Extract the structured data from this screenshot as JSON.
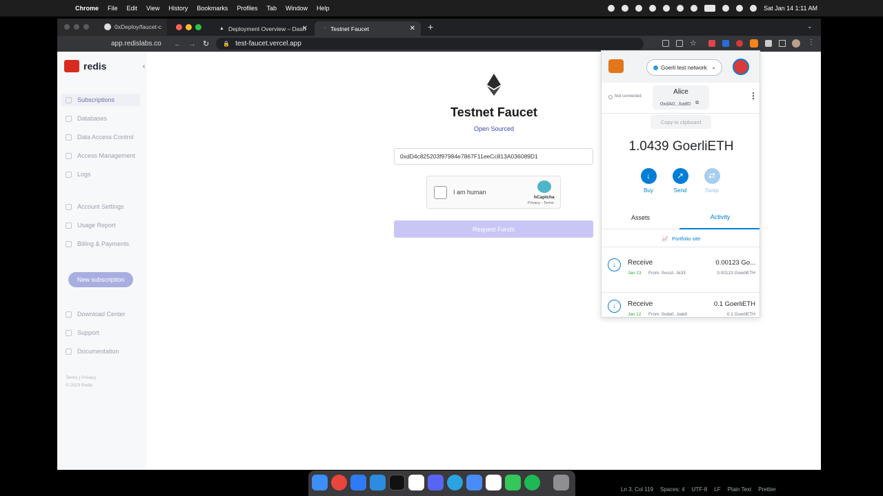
{
  "menubar": {
    "app": "Chrome",
    "items": [
      "File",
      "Edit",
      "View",
      "History",
      "Bookmarks",
      "Profiles",
      "Tab",
      "Window",
      "Help"
    ],
    "clock": "Sat Jan 14  1:11 AM"
  },
  "back_window": {
    "tab_label": "0xDeploy/faucet-c",
    "url": "app.redislabs.co",
    "logo": "redis",
    "nav": [
      "Subscriptions",
      "Databases",
      "Data Access Control",
      "Access Management",
      "Logs"
    ],
    "nav2": [
      "Account Settings",
      "Usage Report",
      "Billing & Payments"
    ],
    "new_subscription": "New subscription",
    "nav3": [
      "Download Center",
      "Support",
      "Documentation"
    ],
    "footer_links": "Terms  |  Privacy",
    "copyright": "© 2023 Redis"
  },
  "front_window": {
    "tabs": [
      {
        "label": "Deployment Overview – Dashb"
      },
      {
        "label": "Testnet Faucet"
      }
    ],
    "url": "test-faucet.vercel.app"
  },
  "faucet": {
    "title": "Testnet Faucet",
    "subtitle": "Open Sourced",
    "address": "0xdD4c825203f97984e7867F11eeCc813A036089D1",
    "captcha_label": "I am human",
    "captcha_brand": "hCaptcha",
    "captcha_links": "Privacy - Terms",
    "request_button": "Request Funds"
  },
  "metamask": {
    "network": "Goerli test network",
    "connection": "Not connected",
    "account_name": "Alice",
    "account_address": "0xdA0...ba80",
    "tooltip": "Copy to clipboard",
    "balance": "1.0439 GoerliETH",
    "actions": [
      "Buy",
      "Send",
      "Swap"
    ],
    "tabs": [
      "Assets",
      "Activity"
    ],
    "active_tab": "Activity",
    "portfolio_link": "Portfolio site",
    "transactions": [
      {
        "type": "Receive",
        "date": "Jan 13",
        "from": "From: 0xccd...fe33",
        "amount": "0.00123 Go...",
        "sub_amount": "0.00123 GoerliETH"
      },
      {
        "type": "Receive",
        "date": "Jan 12",
        "from": "From: 0xda0...bab0",
        "amount": "0.1 GoerliETH",
        "sub_amount": "0.1 GoerliETH"
      }
    ],
    "accent": "#037dd6"
  },
  "editor_status": {
    "position": "Ln 3, Col 119",
    "spaces": "Spaces: 4",
    "encoding": "UTF-8",
    "eol": "LF",
    "language": "Plain Text",
    "formatter": "Prettier"
  }
}
